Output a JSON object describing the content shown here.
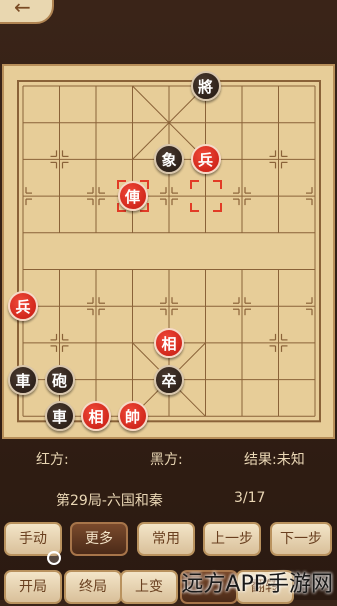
{
  "board": {
    "cols": 9,
    "rows": 10,
    "pieces": [
      {
        "char": "將",
        "side": "black",
        "col": 5,
        "row": 0
      },
      {
        "char": "象",
        "side": "black",
        "col": 4,
        "row": 2
      },
      {
        "char": "兵",
        "side": "red",
        "col": 5,
        "row": 2
      },
      {
        "char": "俥",
        "side": "red",
        "col": 3,
        "row": 3
      },
      {
        "char": "兵",
        "side": "red",
        "col": 0,
        "row": 6
      },
      {
        "char": "相",
        "side": "red",
        "col": 4,
        "row": 7
      },
      {
        "char": "車",
        "side": "black",
        "col": 0,
        "row": 8
      },
      {
        "char": "砲",
        "side": "black",
        "col": 1,
        "row": 8
      },
      {
        "char": "卒",
        "side": "black",
        "col": 4,
        "row": 8
      },
      {
        "char": "車",
        "side": "black",
        "col": 1,
        "row": 9
      },
      {
        "char": "相",
        "side": "red",
        "col": 2,
        "row": 9
      },
      {
        "char": "帥",
        "side": "red",
        "col": 3,
        "row": 9
      }
    ],
    "selection_markers": [
      {
        "col": 3,
        "row": 3
      },
      {
        "col": 5,
        "row": 3
      }
    ]
  },
  "info": {
    "red_label": "红方:",
    "black_label": "黑方:",
    "result_label": "结果:未知"
  },
  "game": {
    "title": "第29局-六国和秦",
    "move_counter": "3/17"
  },
  "buttons_row1": [
    "手动",
    "更多",
    "常用",
    "上一步",
    "下一步"
  ],
  "buttons_row2": [
    "开局",
    "终局",
    "上变",
    "",
    "翻转"
  ],
  "watermark": "远方APP手游网"
}
